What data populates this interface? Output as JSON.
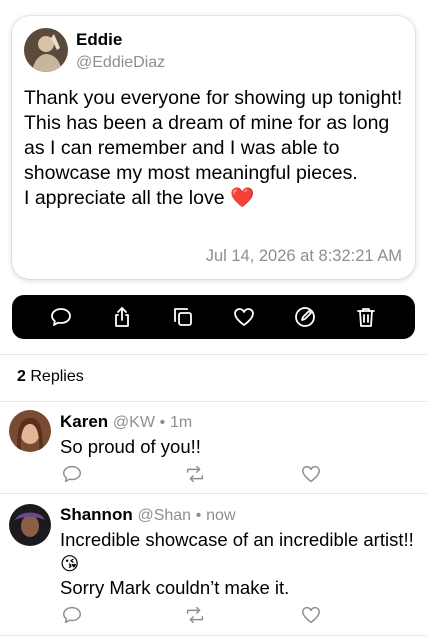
{
  "post": {
    "author_name": "Eddie",
    "author_handle": "@EddieDiaz",
    "text": "Thank you everyone for showing up tonight! This has been a dream of mine for as long as I can remember and I was able to showcase my most meaningful pieces.\nI appreciate all the love ❤️",
    "timestamp": "Jul 14, 2026 at 8:32:21 AM"
  },
  "toolbar": {
    "icons": [
      "reply-icon",
      "share-icon",
      "copy-icon",
      "like-icon",
      "edit-icon",
      "delete-icon"
    ],
    "background": "#000000",
    "icon_color": "#ffffff"
  },
  "replies_header": {
    "count": "2",
    "label": "Replies"
  },
  "replies": [
    {
      "name": "Karen",
      "handle": "@KW",
      "time": "1m",
      "text": "So proud of you!!"
    },
    {
      "name": "Shannon",
      "handle": "@Shan",
      "time": "now",
      "text": "Incredible showcase of an incredible artist!! 😘\nSorry Mark couldn’t make it."
    }
  ],
  "colors": {
    "secondary_text": "#8e8e93",
    "divider": "#e5e5ea"
  }
}
